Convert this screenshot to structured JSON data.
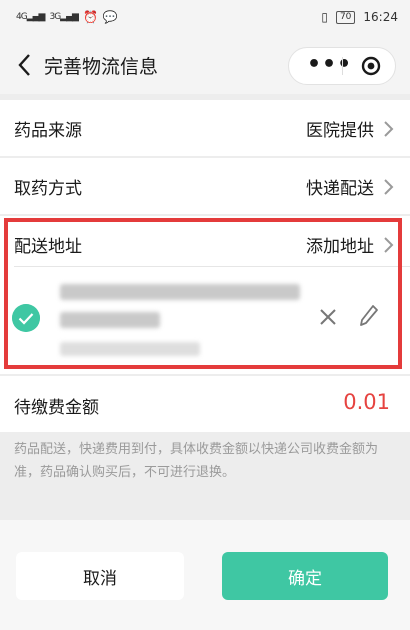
{
  "status_bar": {
    "signal_left": "4G",
    "signal_right": "3G",
    "battery": "70",
    "time": "16:24"
  },
  "navbar": {
    "title": "完善物流信息",
    "more_label": "•••"
  },
  "rows": {
    "source": {
      "label": "药品来源",
      "value": "医院提供"
    },
    "pickup": {
      "label": "取药方式",
      "value": "快递配送"
    },
    "address": {
      "label": "配送地址",
      "value": "添加地址"
    }
  },
  "fee": {
    "label": "待缴费金额",
    "amount": "0.01"
  },
  "note": "药品配送，快递费用到付，具体收费金额以快递公司收费金额为准，药品确认购买后，不可进行退换。",
  "buttons": {
    "cancel": "取消",
    "confirm": "确定"
  },
  "colors": {
    "accent": "#3fc7a3",
    "price": "#e64340",
    "highlight": "#e43b3b"
  }
}
